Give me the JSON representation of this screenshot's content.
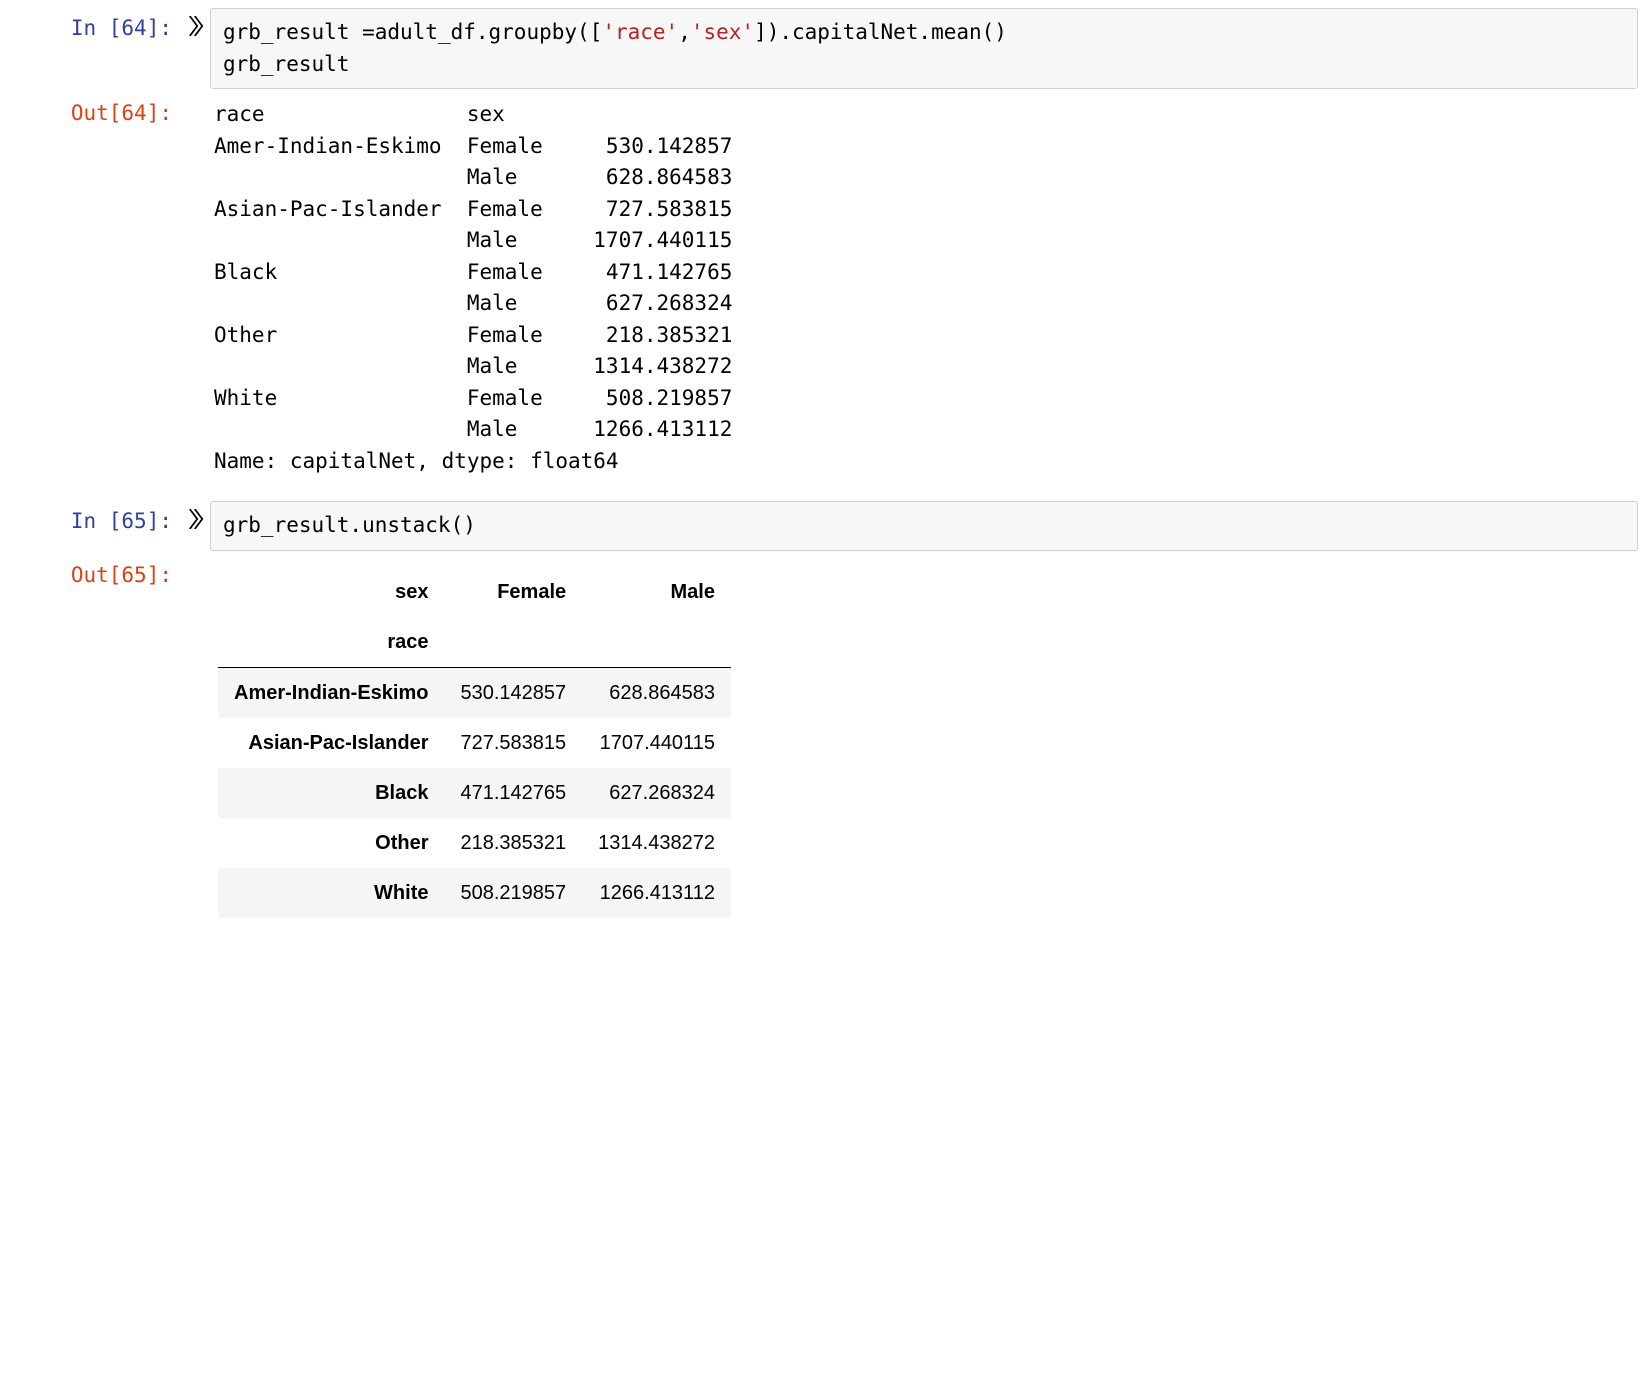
{
  "cells": [
    {
      "in_prompt": "In [64]:",
      "out_prompt": "Out[64]:",
      "code_tokens": [
        {
          "t": "grb_result ",
          "c": "cm-name"
        },
        {
          "t": "=",
          "c": "cm-operator"
        },
        {
          "t": "adult_df.groupby(",
          "c": "cm-name"
        },
        {
          "t": "[",
          "c": "cm-bracket"
        },
        {
          "t": "'race'",
          "c": "cm-string"
        },
        {
          "t": ",",
          "c": "cm-bracket"
        },
        {
          "t": "'sex'",
          "c": "cm-string"
        },
        {
          "t": "]",
          "c": "cm-bracket"
        },
        {
          "t": ").capitalNet.mean()",
          "c": "cm-name"
        },
        {
          "t": "\n",
          "c": ""
        },
        {
          "t": "grb_result",
          "c": "cm-name"
        }
      ],
      "series_output": {
        "header": "race                sex   ",
        "rows": [
          {
            "race": "Amer-Indian-Eskimo",
            "sex": "Female",
            "val": "530.142857"
          },
          {
            "race": "",
            "sex": "Male",
            "val": "628.864583"
          },
          {
            "race": "Asian-Pac-Islander",
            "sex": "Female",
            "val": "727.583815"
          },
          {
            "race": "",
            "sex": "Male",
            "val": "1707.440115"
          },
          {
            "race": "Black",
            "sex": "Female",
            "val": "471.142765"
          },
          {
            "race": "",
            "sex": "Male",
            "val": "627.268324"
          },
          {
            "race": "Other",
            "sex": "Female",
            "val": "218.385321"
          },
          {
            "race": "",
            "sex": "Male",
            "val": "1314.438272"
          },
          {
            "race": "White",
            "sex": "Female",
            "val": "508.219857"
          },
          {
            "race": "",
            "sex": "Male",
            "val": "1266.413112"
          }
        ],
        "footer": "Name: capitalNet, dtype: float64"
      }
    },
    {
      "in_prompt": "In [65]:",
      "out_prompt": "Out[65]:",
      "code_tokens": [
        {
          "t": "grb_result.unstack()",
          "c": "cm-name"
        }
      ],
      "dataframe": {
        "col_header_name": "sex",
        "row_header_name": "race",
        "columns": [
          "Female",
          "Male"
        ],
        "rows": [
          {
            "idx": "Amer-Indian-Eskimo",
            "vals": [
              "530.142857",
              "628.864583"
            ]
          },
          {
            "idx": "Asian-Pac-Islander",
            "vals": [
              "727.583815",
              "1707.440115"
            ]
          },
          {
            "idx": "Black",
            "vals": [
              "471.142765",
              "627.268324"
            ]
          },
          {
            "idx": "Other",
            "vals": [
              "218.385321",
              "1314.438272"
            ]
          },
          {
            "idx": "White",
            "vals": [
              "508.219857",
              "1266.413112"
            ]
          }
        ]
      }
    }
  ]
}
